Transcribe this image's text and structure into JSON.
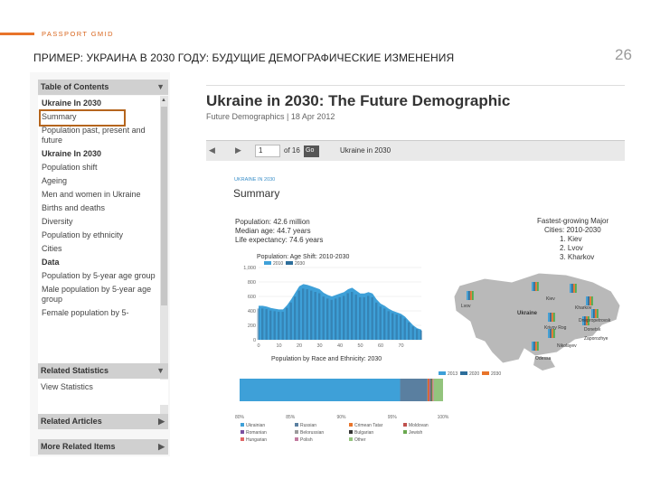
{
  "slide": {
    "brand": "PASSPORT GMID",
    "title": "ПРИМЕР: УКРАИНА В 2030 ГОДУ: БУДУЩИЕ ДЕМОГРАФИЧЕСКИЕ ИЗМЕНЕНИЯ",
    "page_number": "26",
    "accent_color": "#e8742a"
  },
  "toc": {
    "header": "Table of Contents",
    "items": [
      {
        "label": "Ukraine In 2030",
        "bold": true
      },
      {
        "label": "Summary",
        "highlighted": true
      },
      {
        "label": "Population past, present and future"
      },
      {
        "label": "Ukraine In 2030",
        "bold": true
      },
      {
        "label": "Population shift"
      },
      {
        "label": "Ageing"
      },
      {
        "label": "Men and women in Ukraine"
      },
      {
        "label": "Births and deaths"
      },
      {
        "label": "Diversity"
      },
      {
        "label": "Population by ethnicity"
      },
      {
        "label": "Cities"
      },
      {
        "label": "Data",
        "bold": true
      },
      {
        "label": "Population by 5-year age group"
      },
      {
        "label": "Male population by 5-year age group"
      },
      {
        "label": "Female population by 5-"
      }
    ],
    "related_statistics": {
      "header": "Related Statistics",
      "link": "View Statistics"
    },
    "related_articles": "Related Articles",
    "more_related_items": "More Related Items"
  },
  "article": {
    "title": "Ukraine in 2030: The Future Demographic",
    "meta": "Future Demographics | 18 Apr 2012",
    "toolbar": {
      "page_value": "1",
      "of_label": "of 16",
      "go_label": "Go",
      "doc_label": "Ukraine in 2030"
    },
    "summary": {
      "kicker": "UKRAINE IN 2030",
      "title": "Summary",
      "stats": [
        "Population: 42.6 million",
        "Median age: 44.7 years",
        "Life expectancy: 74.6 years"
      ],
      "fastest_title": "Fastest-growing Major",
      "fastest_subtitle": "Cities: 2010-2030",
      "fastest_cities": [
        "1. Kiev",
        "2. Lvov",
        "3. Kharkov"
      ]
    }
  },
  "chart_data": [
    {
      "type": "area",
      "title": "Population: Age Shift: 2010-2030",
      "series": [
        {
          "name": "2010",
          "color": "#3ea0d8"
        },
        {
          "name": "2030",
          "color": "#2d6e9b"
        }
      ],
      "x_ticks": [
        "0",
        "10",
        "20",
        "30",
        "40",
        "50",
        "60",
        "70"
      ],
      "y_ticks": [
        "0",
        "200",
        "400",
        "600",
        "800",
        "1,000"
      ],
      "ylim": [
        0,
        1000
      ],
      "x": [
        0,
        2,
        4,
        6,
        8,
        10,
        12,
        14,
        16,
        18,
        20,
        22,
        24,
        26,
        28,
        30,
        32,
        34,
        36,
        38,
        40,
        42,
        44,
        46,
        48,
        50,
        52,
        54,
        56,
        58,
        60,
        62,
        64,
        66,
        68,
        70,
        72,
        74,
        76,
        78,
        80
      ],
      "values": [
        470,
        470,
        460,
        440,
        430,
        420,
        420,
        480,
        560,
        650,
        740,
        770,
        760,
        740,
        720,
        700,
        650,
        620,
        600,
        620,
        640,
        660,
        700,
        720,
        680,
        640,
        640,
        660,
        640,
        560,
        500,
        470,
        430,
        400,
        380,
        360,
        320,
        260,
        200,
        160,
        140
      ]
    },
    {
      "type": "bar",
      "title": "Population by Race and Ethnicity: 2030",
      "legend": [
        "2013",
        "2020",
        "2030"
      ],
      "legend_colors": [
        "#3ea0d8",
        "#2d6e9b",
        "#e8742a"
      ],
      "x_ticks": [
        "80%",
        "85%",
        "90%",
        "95%",
        "100%"
      ],
      "categories": [
        "Ukrainian",
        "Russian",
        "Crimean Tatar",
        "Moldovan",
        "Romanian",
        "Belorussian",
        "Bulgarian",
        "Jewish",
        "Hungarian",
        "Polish",
        "Other"
      ],
      "values": [
        78.9,
        13.5,
        0.5,
        0.5,
        0.3,
        0.3,
        0.4,
        0.4,
        0.3,
        0.3,
        4.6
      ],
      "colors": [
        "#3ea0d8",
        "#5a7fa0",
        "#e8742a",
        "#c0504d",
        "#7b4fa0",
        "#9b9b9b",
        "#333333",
        "#6aa84f",
        "#e06666",
        "#c27ba0",
        "#93c47d"
      ]
    }
  ],
  "map": {
    "labels": [
      "Lvov",
      "Ukraine",
      "Kiev",
      "Kharkov",
      "Dnepropetrovsk",
      "Donetsk",
      "Zaporozhye",
      "Krivoy Rog",
      "Nikolayev",
      "Odessa"
    ]
  }
}
